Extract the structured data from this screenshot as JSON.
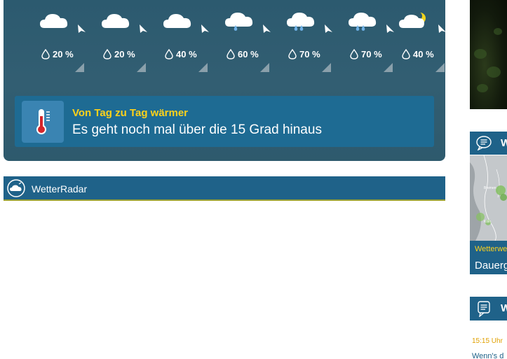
{
  "forecast": {
    "slots": [
      {
        "icon": "cloud-icon",
        "precip": "20 %"
      },
      {
        "icon": "cloud-icon",
        "precip": "20 %"
      },
      {
        "icon": "cloud-icon",
        "precip": "40 %"
      },
      {
        "icon": "cloud-drizzle-icon",
        "precip": "60 %"
      },
      {
        "icon": "cloud-rain-icon",
        "precip": "70 %"
      },
      {
        "icon": "cloud-rain-icon",
        "precip": "70 %"
      },
      {
        "icon": "cloud-moon-icon",
        "precip": "40 %"
      }
    ],
    "notice": {
      "headline": "Von Tag zu Tag wärmer",
      "subline": "Es geht noch mal über die 15 Grad hinaus",
      "icon": "thermometer-icon"
    }
  },
  "radar": {
    "title": "WetterRadar",
    "icon": "radar-cloud-icon"
  },
  "sidebar": {
    "card1": {
      "head_letter": "W",
      "kicker": "Wetterwe",
      "title": "Dauerg",
      "map_labels": [
        "Bremen",
        "Köln"
      ]
    },
    "card2": {
      "head_letter": "W",
      "time": "15:15 Uhr",
      "teaser": "Wenn's d"
    }
  },
  "colors": {
    "panel_bg": "#2e5a6d",
    "bar_blue": "#1f6289",
    "accent_yellow": "#ffd21a",
    "time_orange": "#e0a000"
  }
}
